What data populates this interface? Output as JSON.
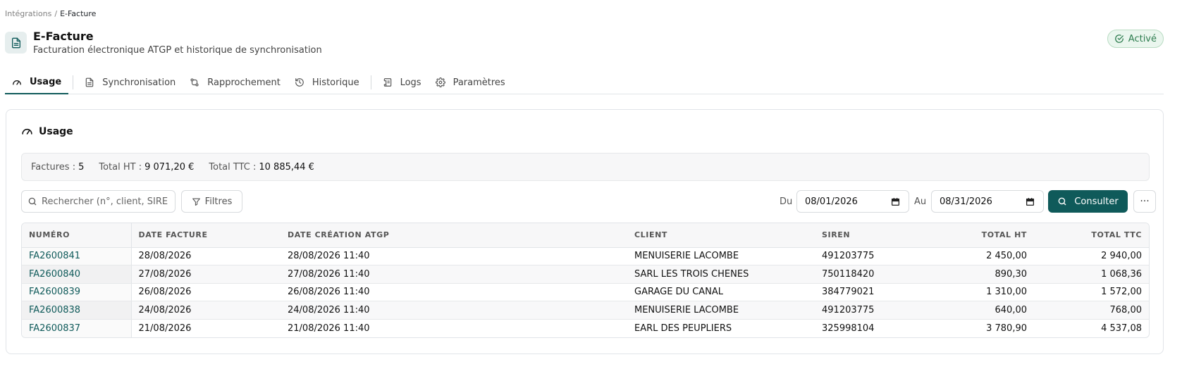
{
  "breadcrumb": {
    "parent": "Intégrations",
    "separator": "/",
    "current": "E-Facture"
  },
  "header": {
    "icon": "document-icon",
    "title": "E-Facture",
    "subtitle": "Facturation électronique ATGP et historique de synchronisation",
    "status": "Activé"
  },
  "tabs": [
    {
      "label": "Usage",
      "icon": "gauge-icon",
      "active": true
    },
    {
      "label": "Synchronisation",
      "icon": "document-icon"
    },
    {
      "label": "Rapprochement",
      "icon": "swap-icon"
    },
    {
      "label": "Historique",
      "icon": "history-icon"
    },
    {
      "label": "Logs",
      "icon": "scroll-icon"
    },
    {
      "label": "Paramètres",
      "icon": "gear-icon"
    }
  ],
  "card": {
    "title": "Usage"
  },
  "summary": {
    "invoices_label": "Factures :",
    "invoices_value": "5",
    "total_ht_label": "Total HT :",
    "total_ht_value": "9 071,20 €",
    "total_ttc_label": "Total TTC :",
    "total_ttc_value": "10 885,44 €"
  },
  "toolbar": {
    "search_placeholder": "Rechercher (n°, client, SIRE",
    "filters_label": "Filtres",
    "from_label": "Du",
    "from_value": "08/01/2026",
    "to_label": "Au",
    "to_value": "08/31/2026",
    "consult_label": "Consulter",
    "more_label": "···"
  },
  "table": {
    "columns": [
      "NUMÉRO",
      "DATE FACTURE",
      "DATE CRÉATION ATGP",
      "CLIENT",
      "SIREN",
      "TOTAL HT",
      "TOTAL TTC"
    ],
    "rows": [
      [
        "FA2600841",
        "28/08/2026",
        "28/08/2026 11:40",
        "MENUISERIE LACOMBE",
        "491203775",
        "2 450,00",
        "2 940,00"
      ],
      [
        "FA2600840",
        "27/08/2026",
        "27/08/2026 11:40",
        "SARL LES TROIS CHENES",
        "750118420",
        "890,30",
        "1 068,36"
      ],
      [
        "FA2600839",
        "26/08/2026",
        "26/08/2026 11:40",
        "GARAGE DU CANAL",
        "384779021",
        "1 310,00",
        "1 572,00"
      ],
      [
        "FA2600838",
        "24/08/2026",
        "24/08/2026 11:40",
        "MENUISERIE LACOMBE",
        "491203775",
        "640,00",
        "768,00"
      ],
      [
        "FA2600837",
        "21/08/2026",
        "21/08/2026 11:40",
        "EARL DES PEUPLIERS",
        "325998104",
        "3 780,90",
        "4 537,08"
      ]
    ]
  },
  "colors": {
    "accent": "#0f5a5a",
    "status_green": "#2e7d4f"
  }
}
